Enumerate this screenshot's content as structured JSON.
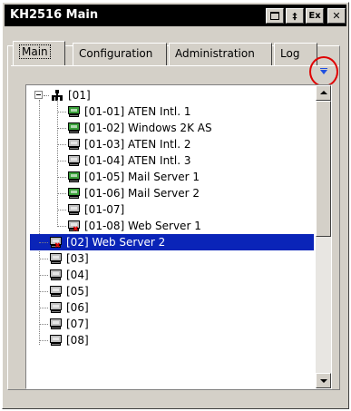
{
  "window": {
    "title": "KH2516 Main"
  },
  "titlebar_buttons": [
    {
      "name": "restore",
      "glyph": ""
    },
    {
      "name": "pin",
      "glyph": "‡"
    },
    {
      "name": "exit",
      "glyph": "Ex"
    },
    {
      "name": "close",
      "glyph": "✕"
    }
  ],
  "tabs": [
    {
      "label": "Main",
      "active": true
    },
    {
      "label": "Configuration",
      "active": false
    },
    {
      "label": "Administration",
      "active": false
    },
    {
      "label": "Log",
      "active": false
    }
  ],
  "sort_icon": "sort-down-icon",
  "tree": {
    "root_label": "[01]",
    "root_icon": "network-icon",
    "children": [
      {
        "label": "[01-01] ATEN Intl. 1",
        "status": "online"
      },
      {
        "label": "[01-02] Windows 2K AS",
        "status": "online"
      },
      {
        "label": "[01-03] ATEN Intl. 2",
        "status": "offline"
      },
      {
        "label": "[01-04] ATEN Intl. 3",
        "status": "offline"
      },
      {
        "label": "[01-05] Mail Server 1",
        "status": "online"
      },
      {
        "label": "[01-06] Mail Server 2",
        "status": "online"
      },
      {
        "label": "[01-07]",
        "status": "offline"
      },
      {
        "label": "[01-08] Web Server 1",
        "status": "warning"
      }
    ],
    "top_level": [
      {
        "label": "[02] Web Server 2",
        "status": "warning",
        "selected": true
      },
      {
        "label": "[03]",
        "status": "offline"
      },
      {
        "label": "[04]",
        "status": "offline"
      },
      {
        "label": "[05]",
        "status": "offline"
      },
      {
        "label": "[06]",
        "status": "offline"
      },
      {
        "label": "[07]",
        "status": "offline"
      },
      {
        "label": "[08]",
        "status": "offline"
      }
    ]
  },
  "colors": {
    "titlebar": "#000000",
    "selection": "#0a24b8",
    "online_monitor": "#3aa03a",
    "highlight_circle": "#e00000",
    "sort_icon": "#2050e0"
  }
}
